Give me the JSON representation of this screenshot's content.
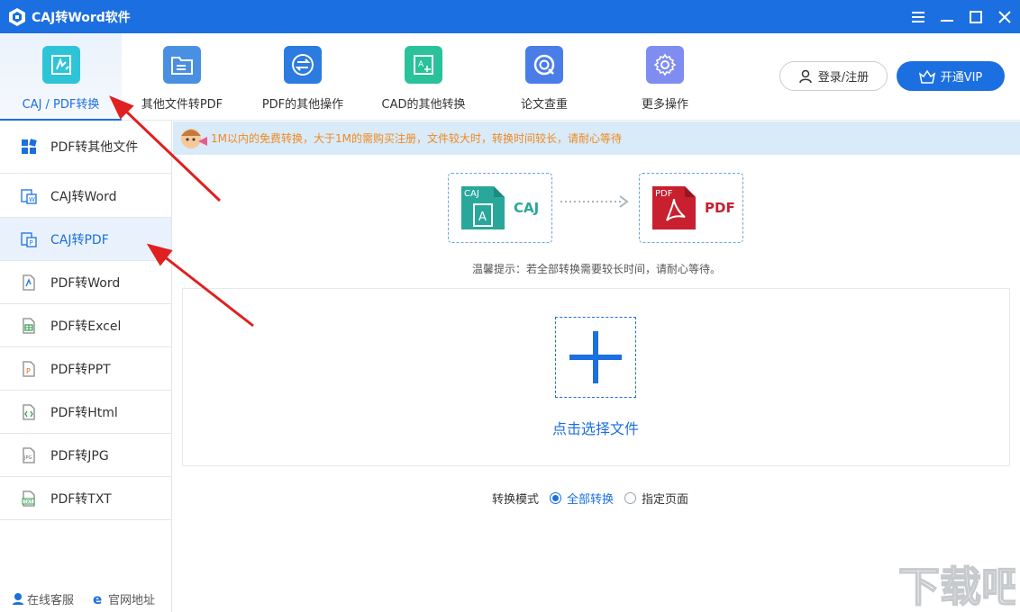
{
  "app": {
    "title": "CAJ转Word软件"
  },
  "toolbar": {
    "tabs": [
      {
        "label": "CAJ / PDF转换",
        "icon": "pdf-convert-icon",
        "color": "#2ec4d8"
      },
      {
        "label": "其他文件转PDF",
        "icon": "folder-icon",
        "color": "#4a90e2"
      },
      {
        "label": "PDF的其他操作",
        "icon": "swap-arrows-icon",
        "color": "#2b7be0"
      },
      {
        "label": "CAD的其他转换",
        "icon": "cad-drawing-icon",
        "color": "#29c29a"
      },
      {
        "label": "论文查重",
        "icon": "search-at-icon",
        "color": "#4a7de8"
      },
      {
        "label": "更多操作",
        "icon": "gear-icon",
        "color": "#7f8cf0"
      }
    ],
    "login_label": "登录/注册",
    "vip_label": "开通VIP"
  },
  "sidebar": {
    "items": [
      {
        "label": "PDF转其他文件",
        "icon": "grid-icon"
      },
      {
        "label": "CAJ转Word",
        "icon": "caj-word-icon"
      },
      {
        "label": "CAJ转PDF",
        "icon": "caj-pdf-icon"
      },
      {
        "label": "PDF转Word",
        "icon": "pdf-word-icon"
      },
      {
        "label": "PDF转Excel",
        "icon": "excel-icon"
      },
      {
        "label": "PDF转PPT",
        "icon": "ppt-icon"
      },
      {
        "label": "PDF转Html",
        "icon": "html-icon"
      },
      {
        "label": "PDF转JPG",
        "icon": "jpg-icon"
      },
      {
        "label": "PDF转TXT",
        "icon": "txt-icon"
      }
    ],
    "active_index": 2,
    "footer": {
      "service_label": "在线客服",
      "website_label": "官网地址"
    }
  },
  "notice": {
    "text": "1M以内的免费转换，大于1M的需购买注册，文件较大时，转换时间较长，请耐心等待"
  },
  "conversion": {
    "source_tag": "CAJ",
    "source_label": "CAJ",
    "source_letter": "A",
    "target_tag": "PDF",
    "target_label": "PDF",
    "source_color": "#2aa79b",
    "target_color": "#c8202f"
  },
  "hint": "温馨提示：若全部转换需要较长时间，请耐心等待。",
  "drop": {
    "label": "点击选择文件"
  },
  "mode": {
    "label": "转换模式",
    "options": [
      {
        "label": "全部转换",
        "selected": true
      },
      {
        "label": "指定页面",
        "selected": false
      }
    ]
  },
  "watermark": {
    "text": "下载吧"
  }
}
